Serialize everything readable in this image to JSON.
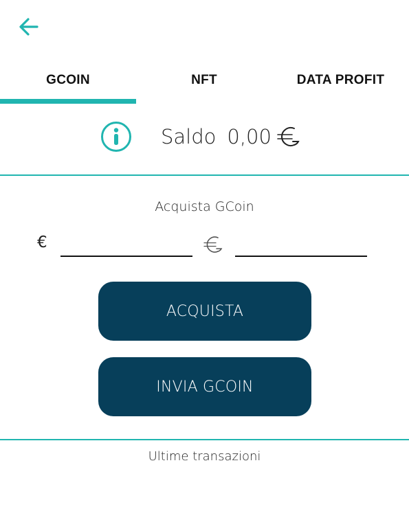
{
  "colors": {
    "accent": "#20b5b0",
    "button_bg": "#073f5a",
    "button_text": "#ffffff",
    "text": "#222222"
  },
  "header": {
    "back_icon": "arrow-left-icon"
  },
  "tabs": [
    {
      "label": "GCOIN",
      "active": true
    },
    {
      "label": "NFT",
      "active": false
    },
    {
      "label": "DATA PROFIT",
      "active": false
    }
  ],
  "balance": {
    "info_icon": "info-icon",
    "label": "Saldo",
    "value": "0,00",
    "currency_icon": "gcoin-symbol-icon"
  },
  "purchase": {
    "title": "Acquista GCoin",
    "eur_symbol": "€",
    "eur_value": "",
    "gcoin_value": "",
    "buy_label": "ACQUISTA",
    "send_label": "INVIA GCOIN"
  },
  "transactions": {
    "title": "Ultime transazioni"
  }
}
